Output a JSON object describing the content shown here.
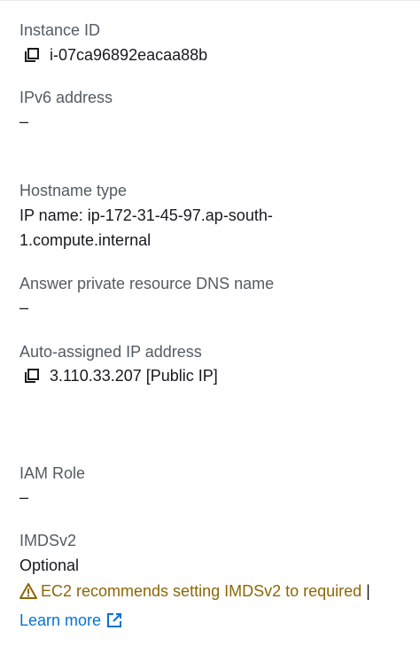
{
  "fields": {
    "instance_id": {
      "label": "Instance ID",
      "value": "i-07ca96892eacaa88b",
      "icon": "copy-icon"
    },
    "ipv6": {
      "label": "IPv6 address",
      "value": "–"
    },
    "hostname_type": {
      "label": "Hostname type",
      "value_line1": "IP name: ip-172-31-45-97.ap-south-",
      "value_line2": "1.compute.internal"
    },
    "answer_private_dns": {
      "label": "Answer private resource DNS name",
      "value": "–"
    },
    "auto_assigned_ip": {
      "label": "Auto-assigned IP address",
      "value": "3.110.33.207 [Public IP]",
      "icon": "copy-icon"
    },
    "iam_role": {
      "label": "IAM Role",
      "value": "–"
    },
    "imdsv2": {
      "label": "IMDSv2",
      "value": "Optional",
      "warning": "EC2 recommends setting IMDSv2 to required",
      "separator": "|",
      "learn_more": "Learn more"
    }
  },
  "colors": {
    "label": "#545b64",
    "value": "#16191f",
    "warning": "#8d6605",
    "link": "#0972d3"
  }
}
